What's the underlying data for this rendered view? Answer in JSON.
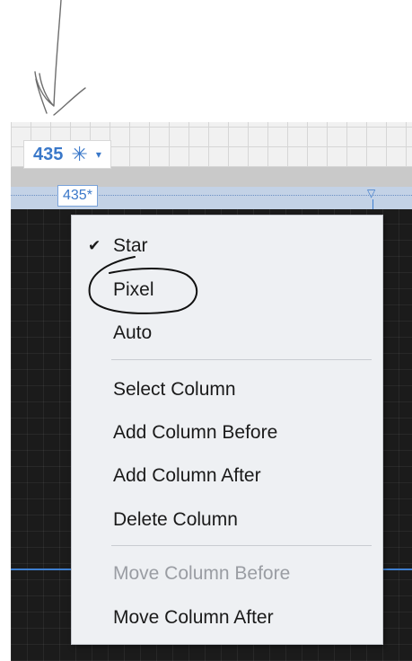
{
  "ruler": {
    "size_value": "435",
    "size_unit_icon": "✳",
    "dropdown_icon": "▾",
    "column_label": "435*",
    "column_marker": "▽"
  },
  "menu": {
    "items": [
      {
        "label": "Star",
        "checked": true,
        "disabled": false
      },
      {
        "label": "Pixel",
        "checked": false,
        "disabled": false
      },
      {
        "label": "Auto",
        "checked": false,
        "disabled": false
      },
      {
        "label": "Select Column",
        "checked": false,
        "disabled": false
      },
      {
        "label": "Add Column Before",
        "checked": false,
        "disabled": false
      },
      {
        "label": "Add Column After",
        "checked": false,
        "disabled": false
      },
      {
        "label": "Delete Column",
        "checked": false,
        "disabled": false
      },
      {
        "label": "Move Column Before",
        "checked": false,
        "disabled": true
      },
      {
        "label": "Move Column After",
        "checked": false,
        "disabled": false
      }
    ],
    "check_mark": "✔"
  },
  "colors": {
    "accent": "#3a78c9",
    "menu_background": "#eef0f3",
    "canvas": "#1b1b1b"
  }
}
